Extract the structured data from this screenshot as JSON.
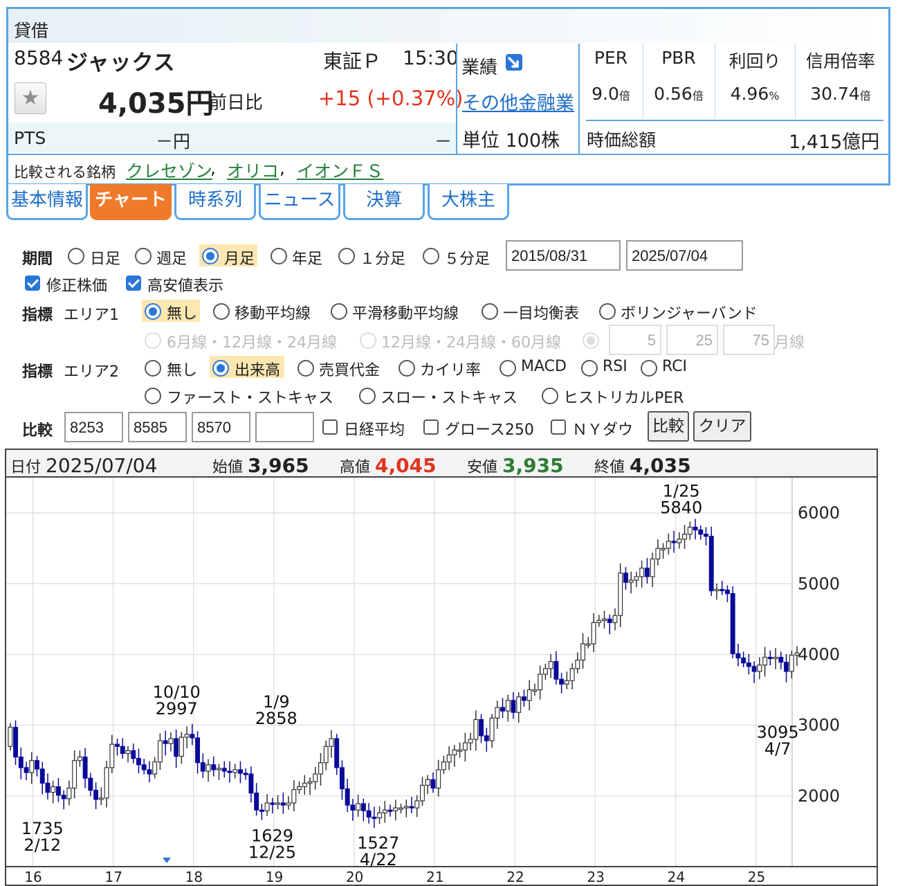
{
  "stock": {
    "badge": "貸借",
    "code": "8584",
    "name": "ジャックス",
    "market": "東証Ｐ",
    "time": "15:30",
    "price": "4,035円",
    "change_label": "前日比",
    "change": "+15 (+0.37%)",
    "pts_label": "PTS",
    "pts_price": "－円",
    "pts_change": "－",
    "perf_label": "業績",
    "sector": "その他金融業",
    "unit": "単位 100株",
    "metrics": [
      {
        "label": "PER",
        "value": "9.0",
        "unit": "倍"
      },
      {
        "label": "PBR",
        "value": "0.56",
        "unit": "倍"
      },
      {
        "label": "利回り",
        "value": "4.96",
        "unit": "%"
      },
      {
        "label": "信用倍率",
        "value": "30.74",
        "unit": "倍"
      }
    ],
    "market_cap_label": "時価総額",
    "market_cap": "1,415億円",
    "compare_label": "比較される銘柄",
    "compare": [
      "クレセゾン",
      "オリコ",
      "イオンＦＳ"
    ],
    "compare_sep": ","
  },
  "tabs": [
    "基本情報",
    "チャート",
    "時系列",
    "ニュース",
    "決算",
    "大株主"
  ],
  "active_tab": "チャート",
  "period": {
    "label": "期間",
    "options": [
      "日足",
      "週足",
      "月足",
      "年足",
      "１分足",
      "５分足"
    ],
    "selected": "月足",
    "from": "2015/08/31",
    "to": "2025/07/04"
  },
  "checks": [
    {
      "label": "修正株価",
      "checked": true
    },
    {
      "label": "高安値表示",
      "checked": true
    }
  ],
  "area1": {
    "label": "指標",
    "sublabel": "エリア1",
    "options": [
      "無し",
      "移動平均線",
      "平滑移動平均線",
      "一目均衡表",
      "ボリンジャーバンド"
    ],
    "selected": "無し",
    "ma_options": [
      "6月線・12月線・24月線",
      "12月線・24月線・60月線"
    ],
    "custom": [
      "5",
      "25",
      "75"
    ],
    "custom_suffix": "月線"
  },
  "area2": {
    "label": "指標",
    "sublabel": "エリア2",
    "options": [
      "無し",
      "出来高",
      "売買代金",
      "カイリ率",
      "MACD",
      "RSI",
      "RCI",
      "ファースト・ストキャス",
      "スロー・ストキャス",
      "ヒストリカルPER"
    ],
    "selected": "出来高"
  },
  "compare_ctl": {
    "label": "比較",
    "codes": [
      "8253",
      "8585",
      "8570",
      ""
    ],
    "indexes": [
      "日経平均",
      "グロース250",
      "ＮＹダウ"
    ],
    "compare_button": "比較",
    "clear_button": "クリア"
  },
  "chart_info": {
    "date_label": "日付",
    "date": "2025/07/04",
    "open_label": "始値",
    "open": "3,965",
    "high_label": "高値",
    "high": "4,045",
    "low_label": "安値",
    "low": "3,935",
    "close_label": "終値",
    "close": "4,035"
  },
  "colors": {
    "accent": "#5aa4e6",
    "active_tab": "#f07a2b",
    "up": "#e0341f",
    "down_text": "#2e7d32",
    "bear_candle": "#0a0a9a",
    "link": "#1d6ec9",
    "peer_link": "#25803d"
  },
  "chart_data": {
    "type": "candlestick",
    "title": "",
    "xlabel": "",
    "ylabel": "",
    "x_ticks": [
      "16",
      "17",
      "18",
      "19",
      "20",
      "21",
      "22",
      "23",
      "24",
      "25"
    ],
    "y_ticks": [
      2000,
      3000,
      4000,
      5000,
      6000
    ],
    "ylim": [
      1000,
      6500
    ],
    "x_range": [
      2015.67,
      2026.5
    ],
    "annotations": [
      {
        "date": "2/12",
        "value": "1735",
        "x": 2016.12,
        "y": 1735,
        "pos": "below"
      },
      {
        "date": "10/10",
        "value": "2997",
        "x": 2017.79,
        "y": 2997,
        "pos": "above"
      },
      {
        "date": "12/25",
        "value": "1629",
        "x": 2018.98,
        "y": 1629,
        "pos": "below"
      },
      {
        "date": "1/9",
        "value": "2858",
        "x": 2019.03,
        "y": 2858,
        "pos": "above"
      },
      {
        "date": "4/22",
        "value": "1527",
        "x": 2020.3,
        "y": 1527,
        "pos": "below"
      },
      {
        "date": "1/25",
        "value": "5840",
        "x": 2024.07,
        "y": 5840,
        "pos": "above"
      },
      {
        "date": "4/7",
        "value": "3095",
        "x": 2025.27,
        "y": 3095,
        "pos": "below"
      }
    ],
    "series": [
      {
        "close": [
          2970,
          2550,
          2400,
          2330,
          2500,
          2380,
          2180,
          2050,
          2130,
          2010,
          1960,
          2110,
          2500,
          2550,
          2250,
          2080,
          1950,
          1970,
          2400,
          2730,
          2700,
          2600,
          2640,
          2530,
          2440,
          2370,
          2310,
          2480,
          2780,
          2740,
          2810,
          2560,
          2830,
          2870,
          2820,
          2470,
          2350,
          2440,
          2370,
          2390,
          2350,
          2330,
          2370,
          2320,
          2310,
          2040,
          1800,
          1790,
          1900,
          1880,
          1900,
          1870,
          1900,
          2090,
          2130,
          2180,
          2200,
          2310,
          2470,
          2700,
          2810,
          2400,
          2100,
          1870,
          1800,
          1890,
          1790,
          1700,
          1690,
          1760,
          1800,
          1790,
          1830,
          1830,
          1850,
          1830,
          1930,
          2150,
          2230,
          2110,
          2370,
          2480,
          2580,
          2650,
          2650,
          2750,
          2800,
          3080,
          2850,
          2780,
          3100,
          3250,
          3200,
          3350,
          3180,
          3400,
          3350,
          3500,
          3500,
          3720,
          3800,
          3900,
          3650,
          3580,
          3630,
          3800,
          3920,
          4150,
          4150,
          4450,
          4480,
          4500,
          4450,
          4550,
          5150,
          5020,
          5050,
          5100,
          5220,
          5100,
          5350,
          5500,
          5500,
          5600,
          5580,
          5630,
          5700,
          5800,
          5760,
          5700,
          5670,
          4900,
          4920,
          4910,
          4860,
          4010,
          3950,
          3880,
          3830,
          3760,
          3850,
          3960,
          3950,
          3960,
          3890,
          3760,
          3990,
          4020
        ]
      }
    ]
  }
}
